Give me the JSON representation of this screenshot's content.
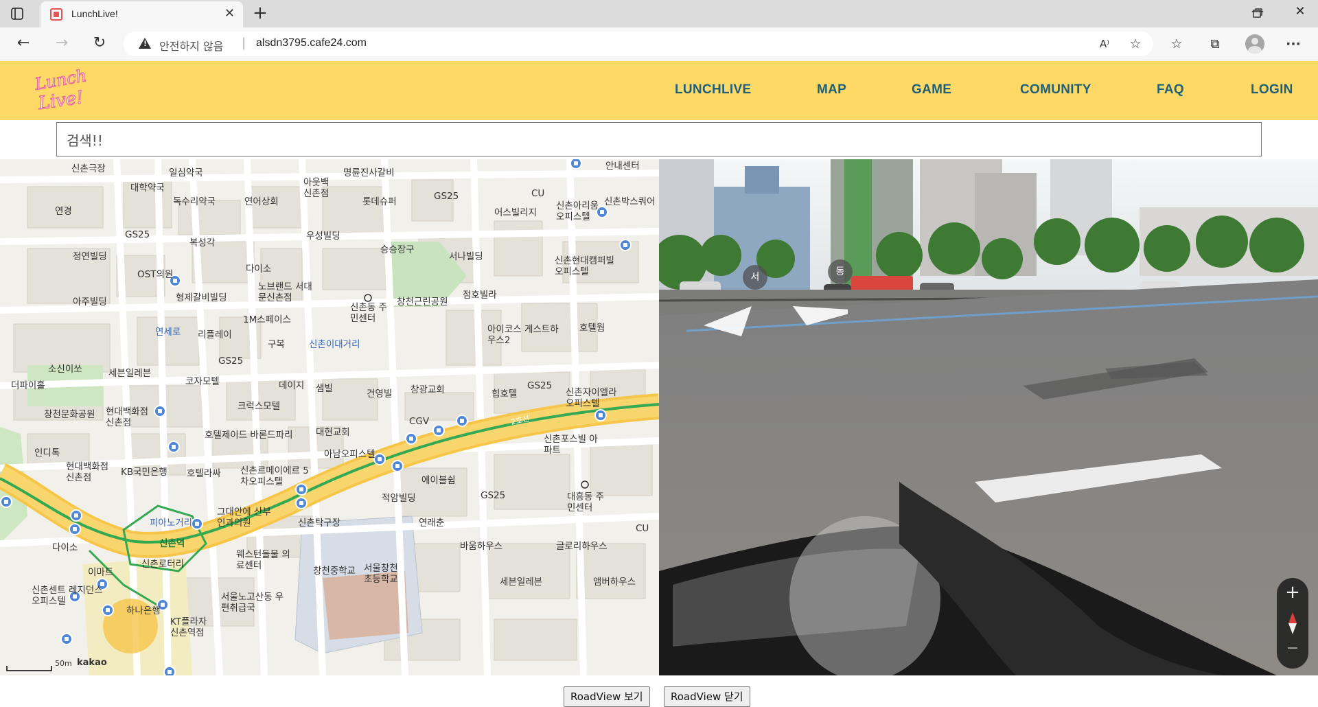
{
  "browser": {
    "tab_title": "LunchLive!",
    "tab_close": "✕",
    "new_tab": "+",
    "insecure_label": "안전하지 않음",
    "url_sep": "|",
    "url": "alsdn3795.cafe24.com",
    "more": "···"
  },
  "header": {
    "logo_text": [
      "Lunch",
      "Live!"
    ],
    "nav": [
      "LUNCHLIVE",
      "MAP",
      "GAME",
      "COMUNITY",
      "FAQ",
      "LOGIN"
    ]
  },
  "search": {
    "text": "검색!!"
  },
  "map": {
    "labels": [
      "신촌극장",
      "일심약국",
      "명륜진사갈비",
      "대학약국",
      "아웃백 신촌점",
      "연경",
      "독수리약국",
      "연어상회",
      "롯데슈퍼",
      "GS25",
      "CU",
      "어스빌리지",
      "신촌아리움 오피스텔",
      "신촌박스쿼어",
      "GS25",
      "복성각",
      "우성빌딩",
      "승승장구",
      "서나빌딩",
      "정연빌딩",
      "OST의원",
      "다이소",
      "신촌현대캠퍼빌 오피스텔",
      "형제갈비빌딩",
      "노브랜드 서대문신촌점",
      "창천근린공원",
      "점호빌라",
      "아주빌딩",
      "1M스페이스",
      "신촌동 주민센터",
      "호텔웜",
      "연세로",
      "리플레이",
      "구복",
      "신촌이대거리",
      "아이코스 게스트하우스2",
      "소신이쏘",
      "GS25",
      "세븐일레븐",
      "코자모텔",
      "데이지",
      "샘빌",
      "건영빌",
      "창광교회",
      "힙호텔",
      "GS25",
      "신촌자이엘라 오피스텔",
      "더파이홀",
      "크럭스모텔",
      "창천문화공원",
      "현대백화점 신촌점",
      "호텔제이드 바론드파리",
      "대현교회",
      "CGV",
      "신촌포스빌 아파트",
      "인디톡",
      "현대백화점 신촌점",
      "KB국민은행",
      "호텔라싸",
      "신촌르메이에르 5차오피스텔",
      "아남오피스텔",
      "에이블쉼",
      "적암빌딩",
      "GS25",
      "대흥동 주민센터",
      "그대안에 산부인과의원",
      "신촌탁구장",
      "연래춘",
      "피아노거리",
      "신촌역",
      "다이소",
      "바움하우스",
      "글로리하우스",
      "웨스턴돌물 의료센터",
      "이마트",
      "신촌로터리",
      "창천중학교",
      "서울창천 초등학교",
      "세븐일레븐",
      "앰버하우스",
      "신촌센트 레지던스오피스텔",
      "하나은행",
      "서울노고산동 우편취급국",
      "KT플라자 신촌역점",
      "2호선",
      "CU",
      "안내센터"
    ],
    "scale": "50m",
    "brand": "kakao"
  },
  "roadview": {
    "dir_west": "서",
    "dir_east": "동",
    "zoom_in": "+",
    "zoom_out": "−"
  },
  "buttons": {
    "show": "RoadView 보기",
    "close": "RoadView 닫기"
  }
}
